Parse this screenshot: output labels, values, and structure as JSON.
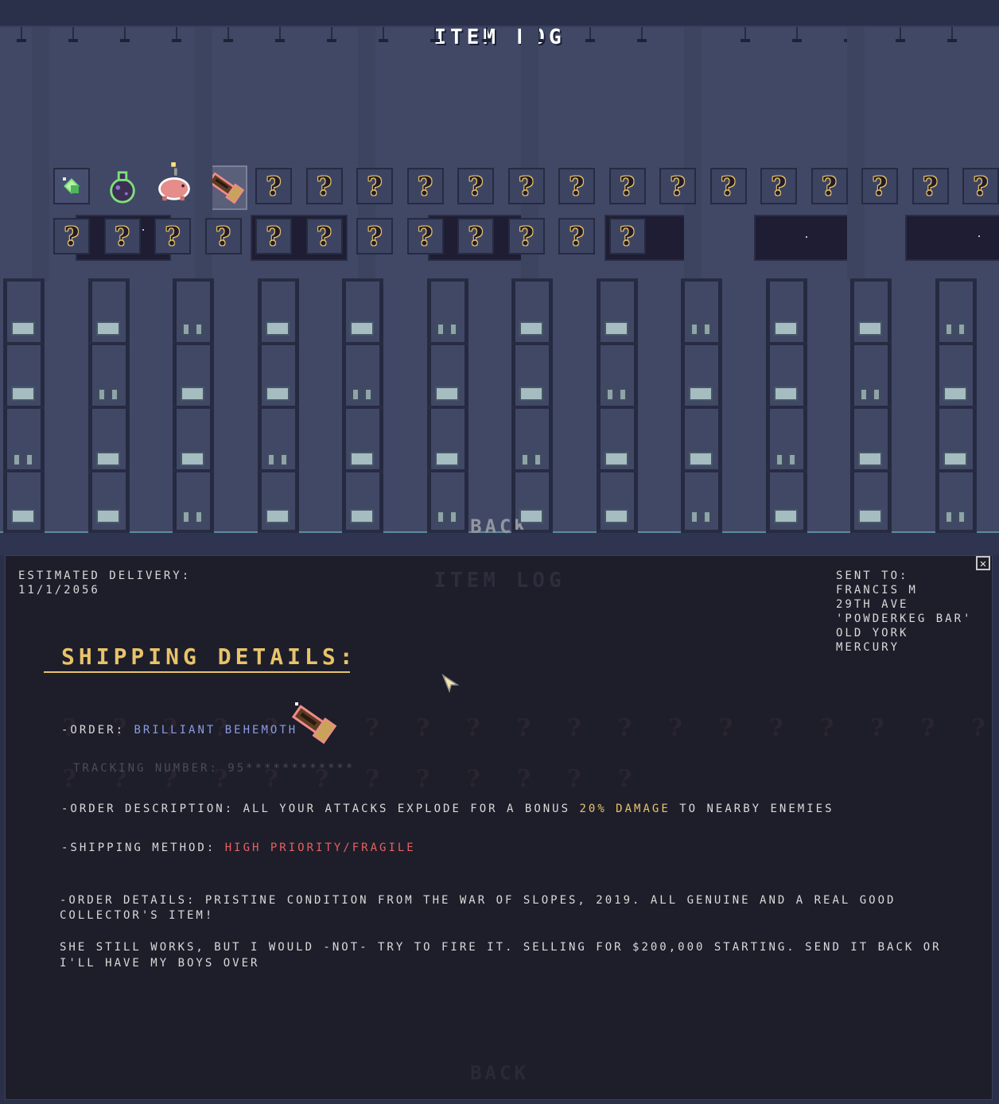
{
  "scene": {
    "title": "ITEM LOG",
    "back_label": "BACK",
    "unknown_glyph": "?",
    "unlocked_items": [
      "green-vial-icon",
      "purple-bomb-flask-icon",
      "piggy-bank-icon",
      "brilliant-behemoth-icon"
    ],
    "row1_unknown_count": 15,
    "row2_unknown_count": 12
  },
  "details": {
    "estimated_delivery_label": "ESTIMATED DELIVERY:",
    "estimated_delivery_date": "11/1/2056",
    "sent_to_label": "SENT TO:",
    "address_lines": [
      "FRANCIS M",
      "29TH AVE",
      "'POWDERKEG BAR'",
      "OLD YORK",
      "MERCURY"
    ],
    "heading": "SHIPPING DETAILS:",
    "order_label": "-ORDER:",
    "order_name": "BRILLIANT BEHEMOTH",
    "tracking_text": "TRACKING NUMBER: 95************",
    "description_label": "-ORDER DESCRIPTION:",
    "description_part1": "ALL YOUR ATTACKS EXPLODE FOR A BONUS",
    "description_highlight": "20% DAMAGE",
    "description_part2": "TO NEARBY ENEMIES",
    "shipping_label": "-SHIPPING METHOD:",
    "shipping_value": "HIGH PRIORITY/FRAGILE",
    "details_line1": "-ORDER DETAILS: PRISTINE CONDITION FROM THE WAR OF SLOPES, 2019. ALL GENUINE AND A REAL GOOD",
    "details_line2": "COLLECTOR'S ITEM!",
    "details_line3": "SHE STILL WORKS, BUT I WOULD -NOT- TRY TO FIRE IT. SELLING FOR $200,000 STARTING. SEND IT BACK OR",
    "details_line4": "I'LL HAVE MY BOYS OVER",
    "close_glyph": "✕"
  },
  "colors": {
    "accent_gold": "#e8c36a",
    "highlight_blue": "#8d9be3",
    "warning_red": "#e86060",
    "panel_bg": "#1d1e2a",
    "scene_bg": "#414866"
  }
}
